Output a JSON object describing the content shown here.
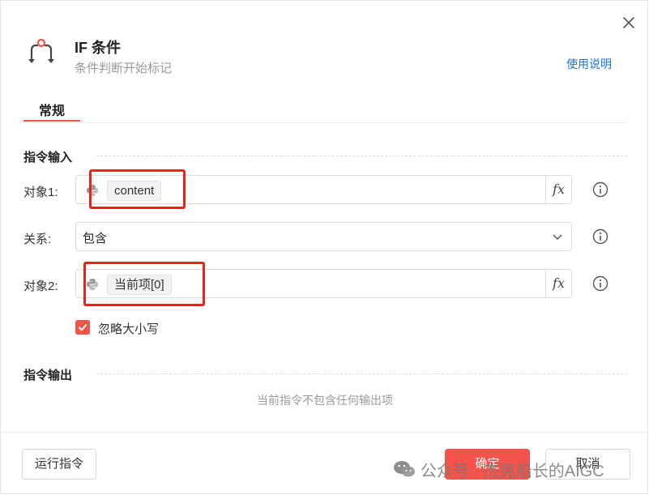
{
  "header": {
    "title": "IF 条件",
    "subtitle": "条件判断开始标记",
    "help_link": "使用说明"
  },
  "tabs": [
    {
      "label": "常规",
      "active": true
    }
  ],
  "input_section": {
    "title": "指令输入",
    "object1": {
      "label": "对象1:",
      "value": "content",
      "fx": "fx"
    },
    "relation": {
      "label": "关系:",
      "value": "包含"
    },
    "object2": {
      "label": "对象2:",
      "value": "当前项[0]",
      "fx": "fx"
    },
    "ignore_case": {
      "label": "忽略大小写",
      "checked": true
    }
  },
  "output_section": {
    "title": "指令输出",
    "empty_text": "当前指令不包含任何输出项"
  },
  "footer": {
    "run_label": "运行指令",
    "ok_label": "确定",
    "cancel_label": "取消"
  },
  "watermark": {
    "text": "公众号 · 杰克船长的AIGC"
  },
  "colors": {
    "accent": "#f5534b",
    "link": "#1a73d9",
    "highlight_box": "#e8221c"
  },
  "icons": [
    "if-branch-icon",
    "close-icon",
    "python-icon",
    "fx-icon",
    "info-icon",
    "chevron-down-icon",
    "check-icon",
    "wechat-icon"
  ]
}
